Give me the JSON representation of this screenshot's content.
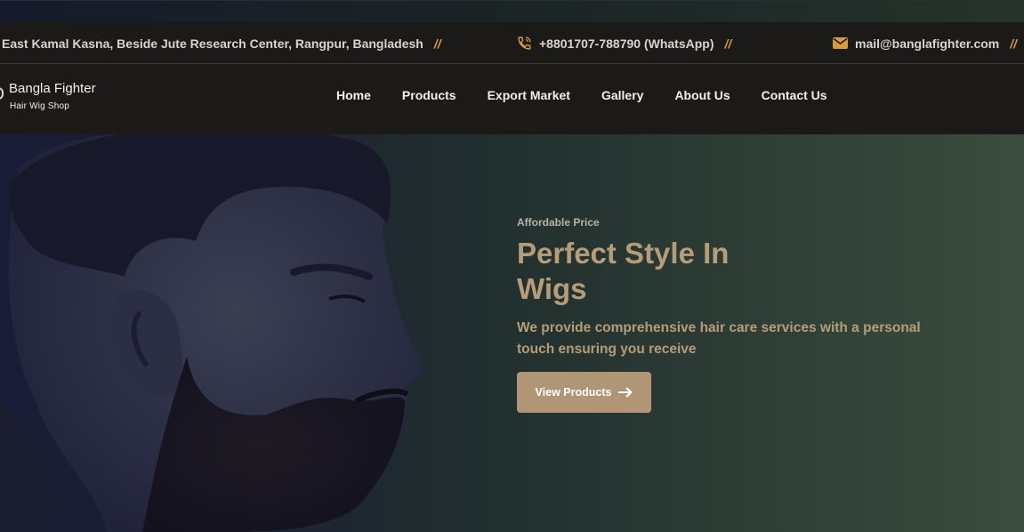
{
  "info_bar": {
    "address": "East Kamal Kasna, Beside Jute Research Center, Rangpur, Bangladesh",
    "phone": "+8801707-788790 (WhatsApp)",
    "email": "mail@banglafighter.com",
    "separator": "//",
    "icons": {
      "phone": "phone-icon",
      "email": "envelope-icon"
    },
    "accent_color": "#d89a3a"
  },
  "logo": {
    "name": "Bangla Fighter",
    "tagline": "Hair Wig Shop"
  },
  "nav": {
    "items": [
      {
        "label": "Home"
      },
      {
        "label": "Products"
      },
      {
        "label": "Export Market"
      },
      {
        "label": "Gallery"
      },
      {
        "label": "About Us"
      },
      {
        "label": "Contact Us"
      }
    ]
  },
  "hero": {
    "eyebrow": "Affordable Price",
    "title": "Perfect Style In Wigs",
    "description": "We provide comprehensive hair care services with a personal touch ensuring you receive",
    "button_label": "View Products",
    "button_icon": "arrow-right-icon",
    "image": "bearded-man-profile",
    "colors": {
      "title": "#b69c77",
      "button": "#b09577"
    }
  }
}
